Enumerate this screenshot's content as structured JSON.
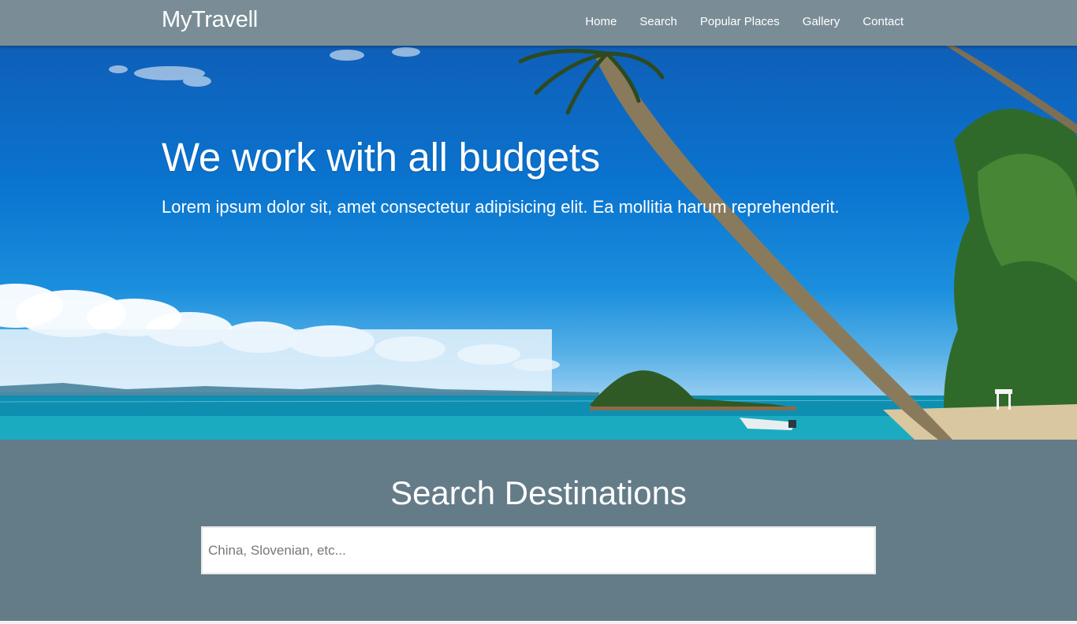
{
  "brand": "MyTravell",
  "nav": {
    "items": [
      {
        "label": "Home"
      },
      {
        "label": "Search"
      },
      {
        "label": "Popular Places"
      },
      {
        "label": "Gallery"
      },
      {
        "label": "Contact"
      }
    ]
  },
  "hero": {
    "title": "We work with all budgets",
    "subtitle": "Lorem ipsum dolor sit, amet consectetur adipisicing elit. Ea mollitia harum reprehenderit."
  },
  "search": {
    "title": "Search Destinations",
    "placeholder": "China, Slovenian, etc...",
    "value": ""
  },
  "colors": {
    "navbar": "#7a8d97",
    "search_section": "#647b88",
    "text": "#ffffff"
  }
}
